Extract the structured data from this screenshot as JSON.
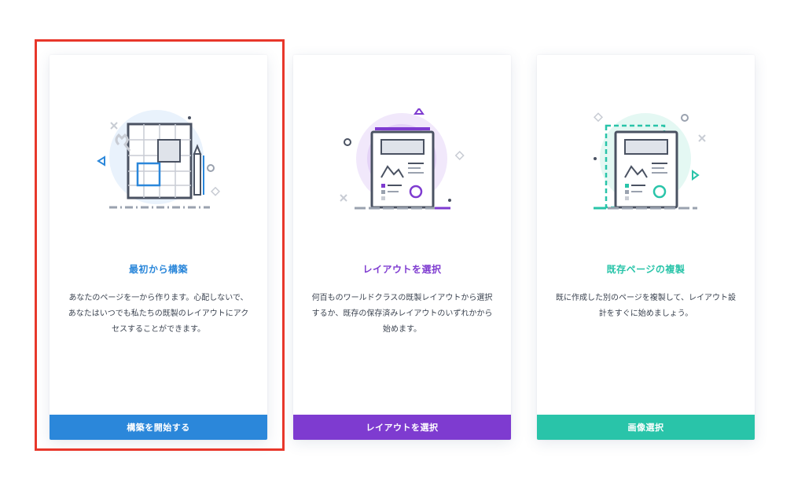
{
  "cards": [
    {
      "title": "最初から構築",
      "description": "あなたのページを一から作ります。心配しないで、あなたはいつでも私たちの既製のレイアウトにアクセスすることができます。",
      "button_label": "構築を開始する",
      "accent_color": "#2b87da",
      "icon": "blueprint-icon"
    },
    {
      "title": "レイアウトを選択",
      "description": "何百ものワールドクラスの既製レイアウトから選択するか、既存の保存済みレイアウトのいずれかから始めます。",
      "button_label": "レイアウトを選択",
      "accent_color": "#7e3bd0",
      "icon": "layout-page-icon"
    },
    {
      "title": "既存ページの複製",
      "description": "既に作成した別のページを複製して、レイアウト設計をすぐに始めましょう。",
      "button_label": "画像選択",
      "accent_color": "#29c4a9",
      "icon": "duplicate-page-icon"
    }
  ],
  "selected_card": 0,
  "highlight_color": "#e8372b"
}
